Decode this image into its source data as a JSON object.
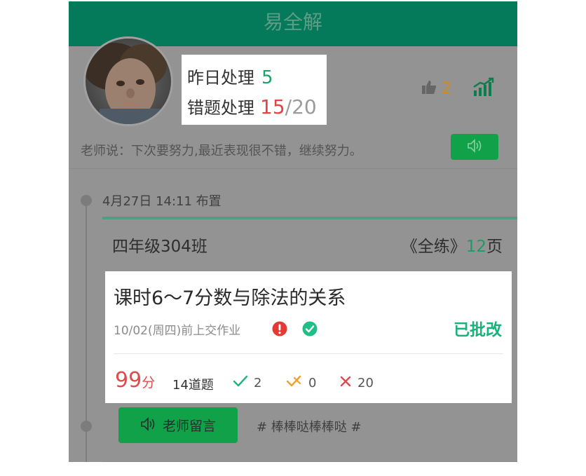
{
  "header": {
    "title": "易全解"
  },
  "summary": {
    "yesterday_label": "昨日处理",
    "yesterday_count": "5",
    "wrong_label": "错题处理",
    "wrong_done": "15",
    "wrong_sep_total": "/20",
    "likes": "2"
  },
  "teacher_comment": "老师说：下次要努力,最近表现很不错，继续努力。",
  "assignment": {
    "assigned_at": "4月27日 14:11 布置",
    "class_name": "四年级304班",
    "book_prefix": "《全练》",
    "book_pages": "12",
    "book_suffix": "页",
    "title": "课时6～7分数与除法的关系",
    "deadline": "10/02(周四)前上交作业",
    "status": "已批改",
    "score": "99",
    "score_unit": "分",
    "question_count": "14道题",
    "correct": "2",
    "partial": "0",
    "wrong": "20",
    "message_button": "老师留言",
    "tags": "# 棒棒哒棒棒哒 #"
  },
  "colors": {
    "header": "#057a5b",
    "accent_green": "#1ca36b",
    "button_green": "#11a249",
    "red": "#e04444",
    "orange": "#d08a1e"
  },
  "icons": [
    "thumbs-up-icon",
    "trend-chart-icon",
    "speaker-icon",
    "alert-icon",
    "check-circle-icon",
    "check-icon",
    "partial-check-icon",
    "cross-icon"
  ]
}
